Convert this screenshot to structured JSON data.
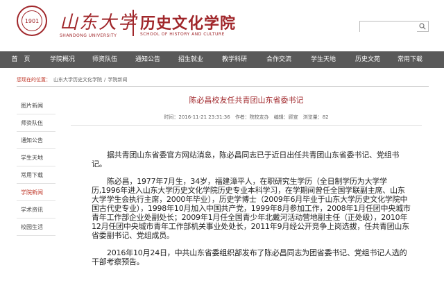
{
  "header": {
    "university_cn": "山东大学",
    "university_en": "SHANDONG UNIVERSITY",
    "seal_year": "1901",
    "dept_cn": "历史文化学院",
    "dept_en": "SCHOOL OF HISTORY AND CULTURE",
    "search_placeholder": "",
    "search_icon": "search-icon",
    "brand_color": "#a0262a"
  },
  "nav": {
    "items": [
      "首　页",
      "学院概况",
      "师资队伍",
      "通知公告",
      "招生就业",
      "教学科研",
      "合作交流",
      "学生天地",
      "历史文苑",
      "常用下载"
    ]
  },
  "breadcrumb": {
    "label": "您现在的位置：",
    "items": [
      "山东大学历史文化学院",
      "学院新闻"
    ],
    "separator": "/"
  },
  "sidebar": {
    "items": [
      "图片新闻",
      "师资队伍",
      "通知公告",
      "学生天地",
      "常用下载",
      "学院新闻",
      "学术资讯",
      "校园生活"
    ],
    "active_index": 5
  },
  "article": {
    "title": "陈必昌校友任共青团山东省委书记",
    "meta": "时间：2016-11-21 23:31:36　作者：院校友办　编辑：顾宣　浏览量：82",
    "paragraphs": [
      "据共青团山东省委官方网站消息，陈必昌同志已于近日出任共青团山东省委书记、党组书记。",
      "陈必昌，1977年7月生，34岁，福建漳平人，在职研究生学历（全日制学历为大学学历,1996年进入山东大学历史文化学院历史专业本科学习，在学期间曾任全国学联副主席、山东大学学生会执行主席，2000年毕业），历史学博士（2009年6月毕业于山东大学历史文化学院中国古代史专业），1998年10月加入中国共产党，1999年8月参加工作，2008年1月任团中央城市青年工作部企业处副处长；2009年1月任全国青少年北戴河活动营地副主任（正处级），2010年12月任团中央城市青年工作部机关事业处处长，2011年9月经公开竞争上岗选拔，任共青团山东省委副书记、党组成员。",
      "2016年10月24日，中共山东省委组织部发布了陈必昌同志为团省委书记、党组书记人选的干部考察预告。"
    ]
  }
}
